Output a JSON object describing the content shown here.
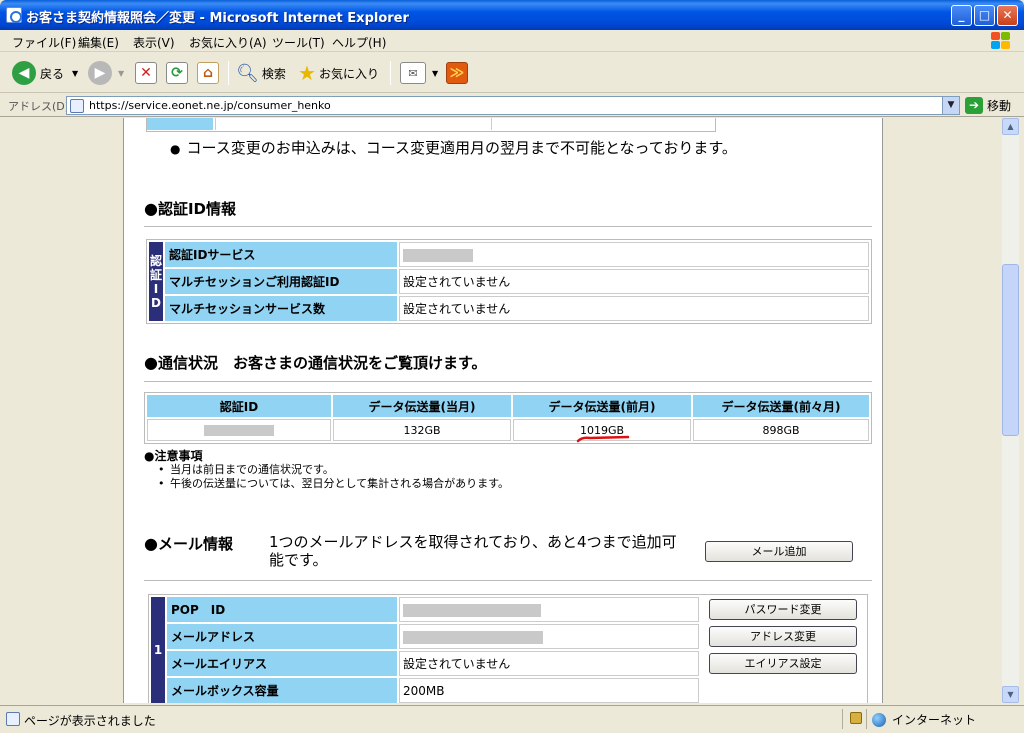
{
  "window": {
    "title": "お客さま契約情報照会／変更 - Microsoft Internet Explorer"
  },
  "menu": [
    "ファイル(F)",
    "編集(E)",
    "表示(V)",
    "お気に入り(A)",
    "ツール(T)",
    "ヘルプ(H)"
  ],
  "toolbar": {
    "back": "戻る",
    "search": "検索",
    "favorites": "お気に入り"
  },
  "address": {
    "label": "アドレス(D)",
    "url": "https://service.eonet.ne.jp/consumer_henko",
    "go": "移動"
  },
  "page": {
    "course_note": "コース変更のお申込みは、コース変更適用月の翌月まで不可能となっております。",
    "auth": {
      "heading": "認証ID情報",
      "side": [
        "認",
        "証",
        "I",
        "D"
      ],
      "rows": [
        {
          "label": "認証IDサービス",
          "value": ""
        },
        {
          "label": "マルチセッションご利用認証ID",
          "value": "設定されていません"
        },
        {
          "label": "マルチセッションサービス数",
          "value": "設定されていません"
        }
      ]
    },
    "traffic": {
      "heading": "通信状況　お客さまの通信状況をご覧頂けます。",
      "columns": [
        "認証ID",
        "データ伝送量(当月)",
        "データ伝送量(前月)",
        "データ伝送量(前々月)"
      ],
      "values": [
        "132GB",
        "1019GB",
        "898GB"
      ],
      "notes_title": "注意事項",
      "notes": [
        "当月は前日までの通信状況です。",
        "午後の伝送量については、翌日分として集計される場合があります。"
      ]
    },
    "mail": {
      "heading": "メール情報",
      "desc_line1": "1つのメールアドレスを取得されており、あと4つまで追加可",
      "desc_line2": "能です。",
      "add_button": "メール追加",
      "index": "1",
      "rows": [
        {
          "label": "POP　ID",
          "value": "",
          "button": "パスワード変更"
        },
        {
          "label": "メールアドレス",
          "value": "",
          "button": "アドレス変更"
        },
        {
          "label": "メールエイリアス",
          "value": "設定されていません",
          "button": "エイリアス設定"
        },
        {
          "label": "メールボックス容量",
          "value": "200MB",
          "button": ""
        }
      ]
    }
  },
  "status": {
    "text": "ページが表示されました",
    "zone": "インターネット"
  }
}
